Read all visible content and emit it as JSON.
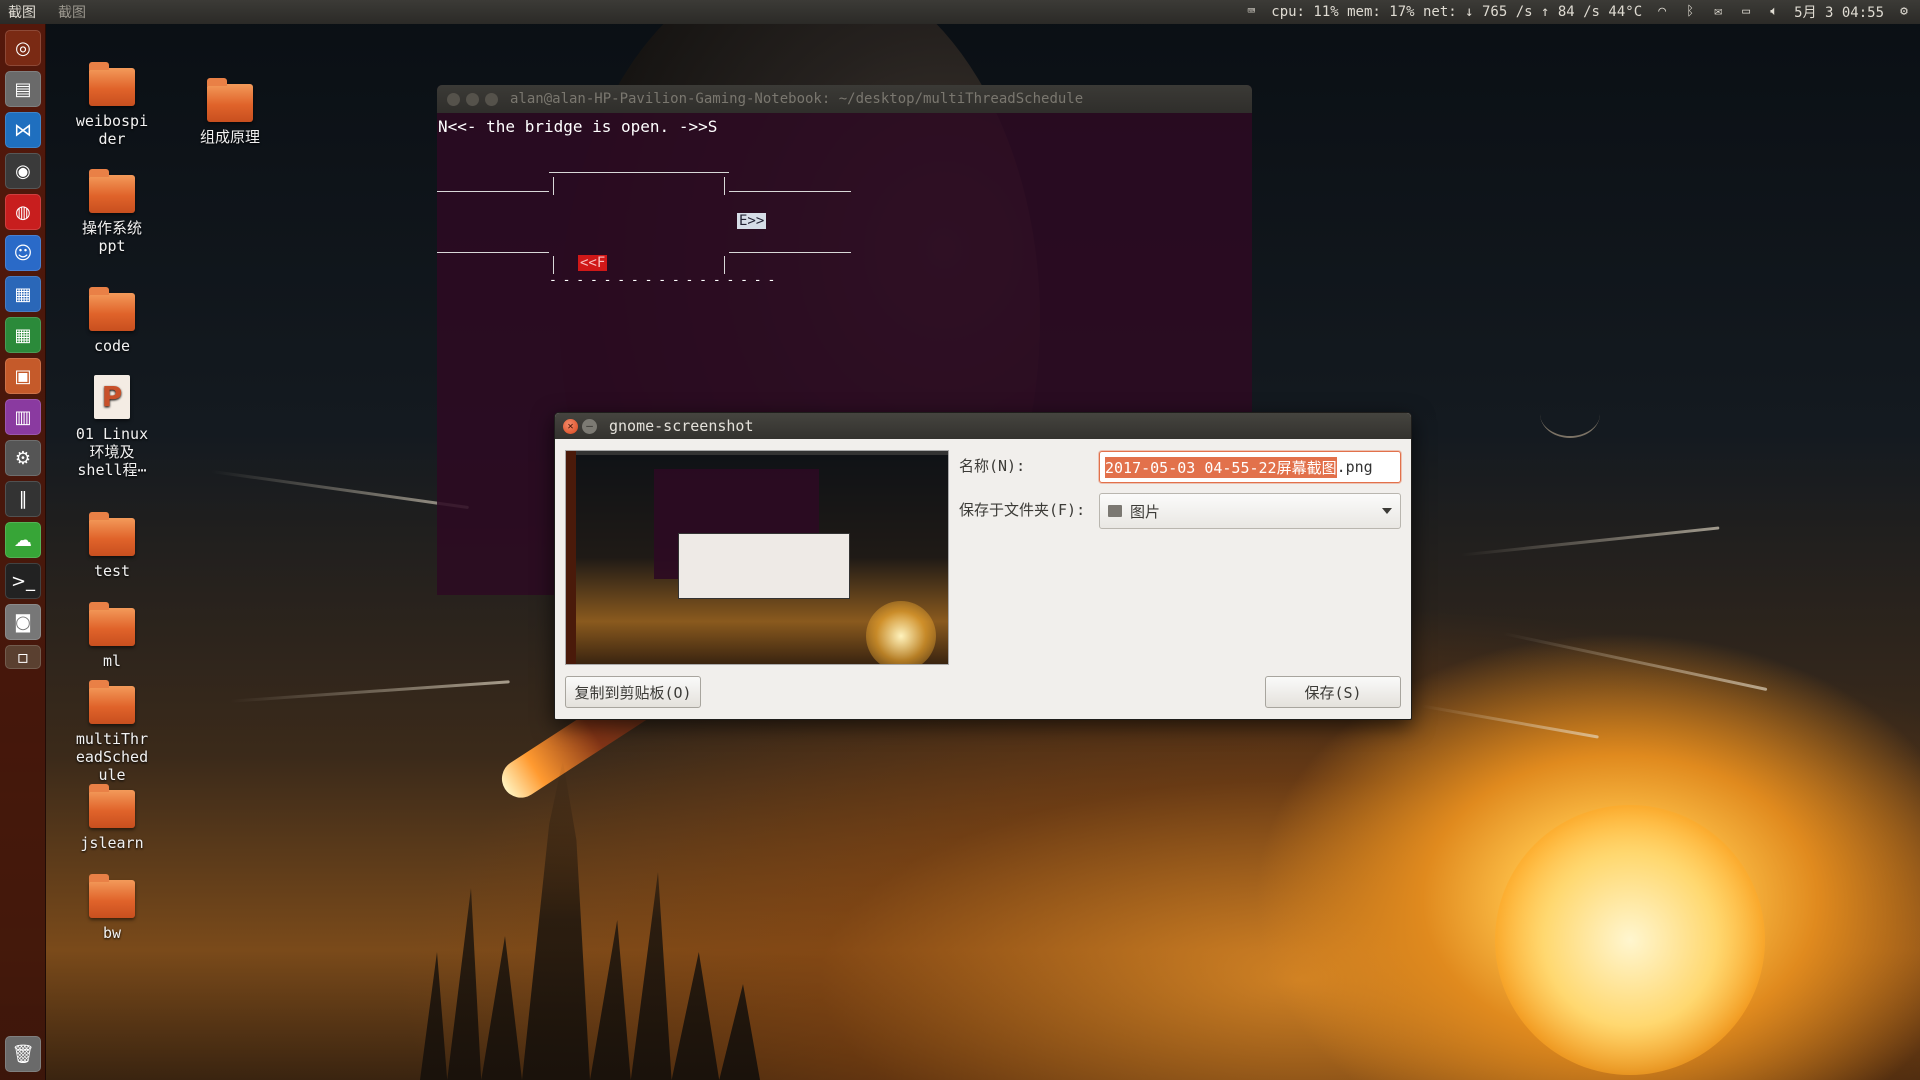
{
  "top_panel": {
    "app_name": "截图",
    "menu_item": "截图",
    "status": "cpu: 11% mem: 17% net: ↓ 765  /s ↑  84  /s 44°C",
    "datetime": "5月  3 04:55"
  },
  "desktop": {
    "icons": [
      {
        "label": "weibospi\nder",
        "l1": "weibospi",
        "l2": "der"
      },
      {
        "label": "组成原理"
      },
      {
        "l1": "操作系统",
        "l2": "ppt"
      },
      {
        "l1": "code"
      },
      {
        "l1": "01 Linux",
        "l2": "环境及",
        "l3": "shell程⋯"
      },
      {
        "l1": "test"
      },
      {
        "l1": "ml"
      },
      {
        "l1": "multiThr",
        "l2": "eadSched",
        "l3": "ule"
      },
      {
        "l1": "jslearn"
      },
      {
        "l1": "bw"
      }
    ]
  },
  "terminal": {
    "title": "alan@alan-HP-Pavilion-Gaming-Notebook: ~/desktop/multiThreadSchedule",
    "line1": "N<<- the bridge is open. ->>S",
    "car_right": "E>>",
    "car_left": "<<F",
    "dashes": "- - - - - - - - - - - - - - - - -"
  },
  "dialog": {
    "title": "gnome-screenshot",
    "name_label": "名称(N):",
    "name_selected": "2017-05-03 04-55-22屏幕截图",
    "name_ext": ".png",
    "folder_label": "保存于文件夹(F):",
    "folder_value": "图片",
    "copy_button": "复制到剪贴板(O)",
    "save_button": "保存(S)"
  },
  "colors": {
    "launcher": "#5a190a",
    "terminal_bg": "#2c0a22",
    "accent": "#e2714b",
    "car_left": "#d01818",
    "car_right": "#d6dde7"
  }
}
